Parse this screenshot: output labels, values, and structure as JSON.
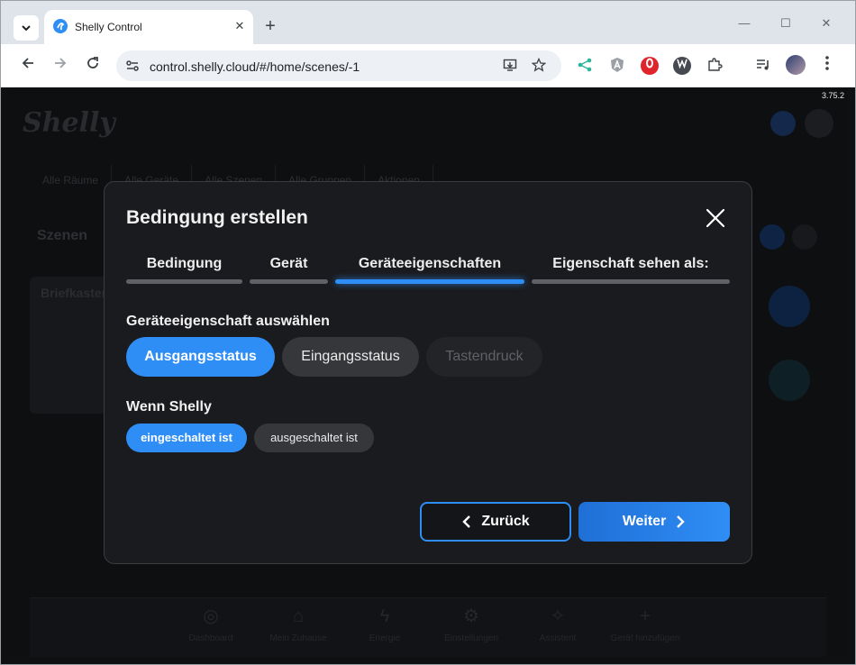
{
  "browser": {
    "tab_title": "Shelly Control",
    "tab_close": "✕",
    "new_tab": "+",
    "url": "control.shelly.cloud/#/home/scenes/-1",
    "window_controls": {
      "minimize": "—",
      "maximize": "☐",
      "close": "✕"
    }
  },
  "app": {
    "version": "3.75.2",
    "logo_text": "Shelly",
    "background_tabs": [
      "Alle Räume",
      "Alle Geräte",
      "Alle Szenen",
      "Alle Gruppen",
      "Aktionen"
    ],
    "background_section": "Szenen",
    "background_card": "Briefkasten",
    "bottom_nav": [
      {
        "icon": "dashboard-icon",
        "glyph": "◎",
        "label": "Dashboard"
      },
      {
        "icon": "home-icon",
        "glyph": "⌂",
        "label": "Mein Zuhause"
      },
      {
        "icon": "energy-icon",
        "glyph": "ϟ",
        "label": "Energie"
      },
      {
        "icon": "settings-icon",
        "glyph": "⚙",
        "label": "Einstellungen"
      },
      {
        "icon": "sparkle-icon",
        "glyph": "✧",
        "label": "Assistent"
      },
      {
        "icon": "add-device-icon",
        "glyph": "+",
        "label": "Gerät hinzufügen"
      }
    ]
  },
  "modal": {
    "title": "Bedingung erstellen",
    "steps": [
      {
        "label": "Bedingung",
        "active": false
      },
      {
        "label": "Gerät",
        "active": false
      },
      {
        "label": "Geräteeigenschaften",
        "active": true
      },
      {
        "label": "Eigenschaft sehen als:",
        "active": false
      }
    ],
    "property_section": {
      "label": "Geräteeigenschaft auswählen",
      "options": [
        {
          "label": "Ausgangsstatus",
          "state": "selected"
        },
        {
          "label": "Eingangsstatus",
          "state": "normal"
        },
        {
          "label": "Tastendruck",
          "state": "disabled"
        }
      ]
    },
    "condition_section": {
      "label": "Wenn Shelly",
      "options": [
        {
          "label": "eingeschaltet ist",
          "state": "selected"
        },
        {
          "label": "ausgeschaltet ist",
          "state": "normal"
        }
      ]
    },
    "back_label": "Zurück",
    "next_label": "Weiter"
  },
  "colors": {
    "accent": "#2f8ef5",
    "modal_bg": "#1a1b1e",
    "page_bg": "#0e0f11"
  }
}
